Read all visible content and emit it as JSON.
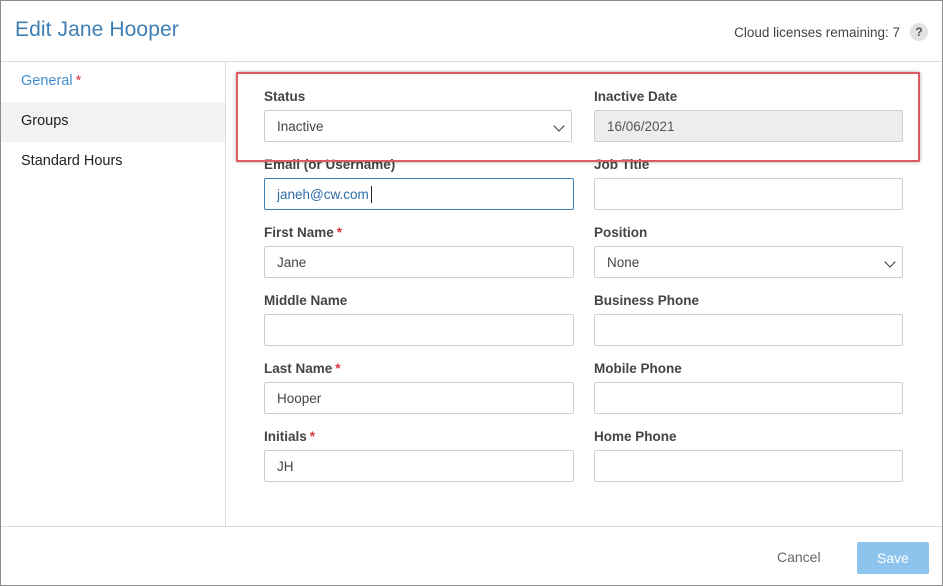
{
  "header": {
    "title": "Edit Jane Hooper",
    "licenses": "Cloud licenses remaining: 7",
    "help": "?"
  },
  "sidebar": {
    "items": [
      {
        "label": "General",
        "required": "*"
      },
      {
        "label": "Groups"
      },
      {
        "label": "Standard Hours"
      }
    ]
  },
  "form": {
    "status": {
      "label": "Status",
      "value": "Inactive"
    },
    "inactive_date": {
      "label": "Inactive Date",
      "value": "16/06/2021"
    },
    "email": {
      "label": "Email (or Username)",
      "value": "janeh@cw.com"
    },
    "job_title": {
      "label": "Job Title",
      "value": ""
    },
    "first_name": {
      "label": "First Name",
      "required": "*",
      "value": "Jane"
    },
    "position": {
      "label": "Position",
      "value": "None"
    },
    "middle_name": {
      "label": "Middle Name",
      "value": ""
    },
    "business_phone": {
      "label": "Business Phone",
      "value": ""
    },
    "last_name": {
      "label": "Last Name",
      "required": "*",
      "value": "Hooper"
    },
    "mobile_phone": {
      "label": "Mobile Phone",
      "value": ""
    },
    "initials": {
      "label": "Initials",
      "required": "*",
      "value": "JH"
    },
    "home_phone": {
      "label": "Home Phone",
      "value": ""
    }
  },
  "footer": {
    "cancel": "Cancel",
    "save": "Save"
  },
  "colors": {
    "title": "#3f7fb3",
    "active_tab": "#3f8fd0",
    "required": "#d9343e",
    "highlight": "#e05a63",
    "save_button": "#8cc4ee"
  }
}
